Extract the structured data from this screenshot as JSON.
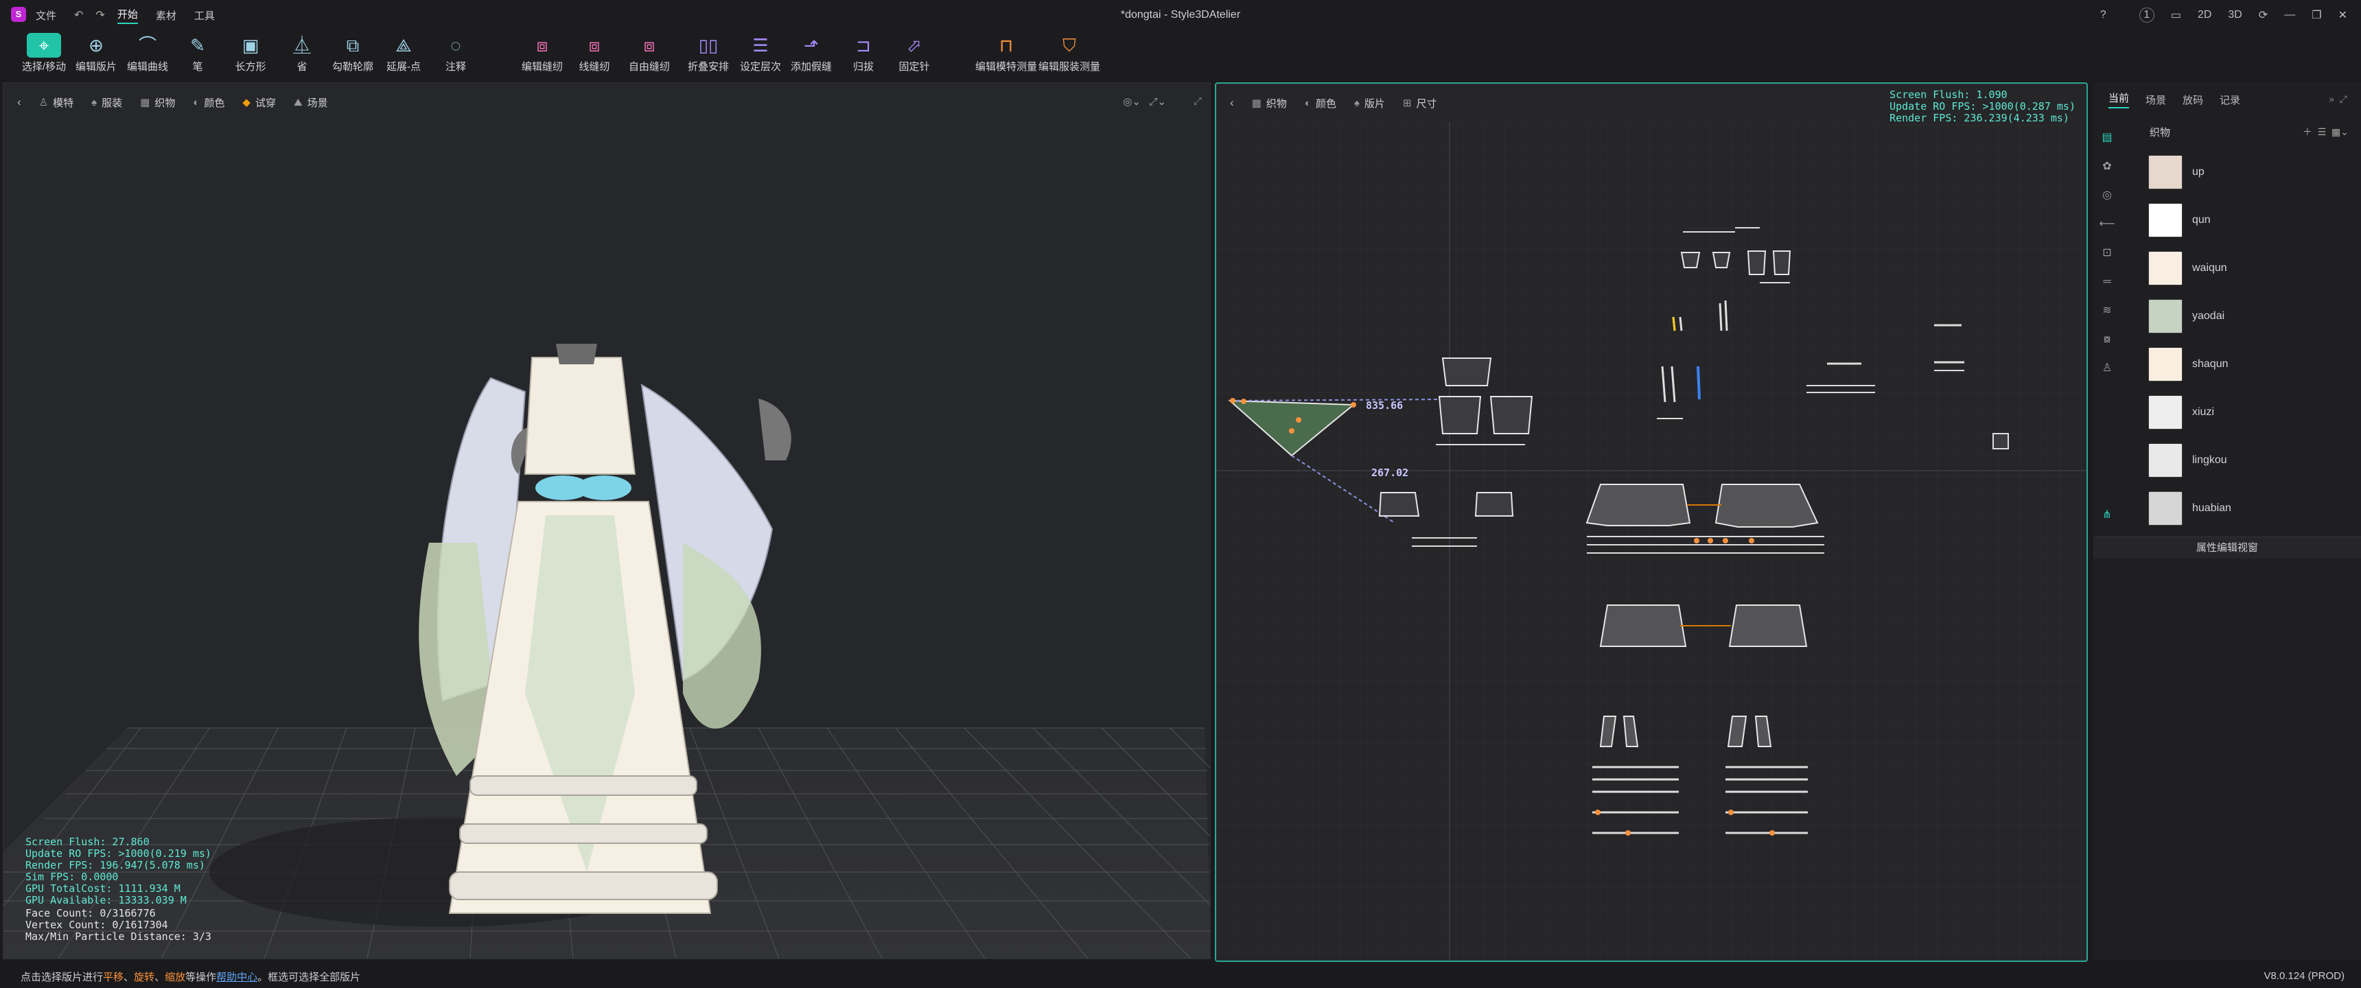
{
  "menu": {
    "items": [
      "文件",
      "开始",
      "素材",
      "工具"
    ],
    "active_index": 1,
    "doc_title": "*dongtai - Style3DAtelier",
    "badge_count": "1",
    "view_modes": [
      "2D",
      "3D"
    ]
  },
  "toolbar": {
    "tools": [
      {
        "label": "选择/移动",
        "icon": "select-move-icon"
      },
      {
        "label": "编辑版片",
        "icon": "edit-pattern-icon"
      },
      {
        "label": "编辑曲线",
        "icon": "edit-curve-icon"
      },
      {
        "label": "笔",
        "icon": "pen-icon"
      },
      {
        "label": "长方形",
        "icon": "rectangle-icon"
      },
      {
        "label": "省",
        "icon": "dart-icon"
      },
      {
        "label": "勾勒轮廓",
        "icon": "trace-outline-icon"
      },
      {
        "label": "延展-点",
        "icon": "extend-point-icon"
      },
      {
        "label": "注释",
        "icon": "annotation-icon"
      },
      {
        "label": "编辑缝纫",
        "icon": "edit-sewing-icon"
      },
      {
        "label": "线缝纫",
        "icon": "line-sewing-icon"
      },
      {
        "label": "自由缝纫",
        "icon": "free-sewing-icon"
      },
      {
        "label": "折叠安排",
        "icon": "fold-arrange-icon"
      },
      {
        "label": "设定层次",
        "icon": "set-layer-icon"
      },
      {
        "label": "添加假缝",
        "icon": "add-tack-icon"
      },
      {
        "label": "归拔",
        "icon": "shrink-stretch-icon"
      },
      {
        "label": "固定针",
        "icon": "pin-icon"
      },
      {
        "label": "编辑模特测量",
        "icon": "edit-avatar-measure-icon"
      },
      {
        "label": "编辑服装测量",
        "icon": "edit-garment-measure-icon"
      }
    ]
  },
  "view3d": {
    "toolbar": [
      "模特",
      "服装",
      "织物",
      "颜色",
      "试穿",
      "场景"
    ],
    "stats_cyan": [
      "Screen Flush: 27.860",
      "Update RO FPS: >1000(0.219 ms)",
      "Render FPS: 196.947(5.078 ms)",
      "Sim FPS: 0.0000",
      "GPU TotalCost: 1111.934 M",
      "GPU Available: 13333.039 M"
    ],
    "stats_white": [
      "Face Count: 0/3166776",
      "Vertex Count: 0/1617304",
      "Max/Min Particle Distance: 3/3"
    ]
  },
  "view2d": {
    "toolbar": [
      "织物",
      "颜色",
      "版片",
      "尺寸"
    ],
    "stats": [
      "Screen Flush: 1.090",
      "Update RO FPS: >1000(0.287 ms)",
      "Render FPS: 236.239(4.233 ms)"
    ],
    "measure_a": "835.66",
    "measure_b": "267.02"
  },
  "side": {
    "tabs": [
      "当前",
      "场景",
      "放码",
      "记录"
    ],
    "active_tab": 0,
    "section_title": "织物",
    "fabrics": [
      {
        "name": "up",
        "color": "#e6d8cc"
      },
      {
        "name": "qun",
        "color": "#ffffff"
      },
      {
        "name": "waiqun",
        "color": "#f8efe2"
      },
      {
        "name": "yaodai",
        "color": "#c6d3c3"
      },
      {
        "name": "shaqun",
        "color": "#f9eee0"
      },
      {
        "name": "xiuzi",
        "color": "#eeeeee"
      },
      {
        "name": "lingkou",
        "color": "#e9e9e9"
      },
      {
        "name": "huabian",
        "color": "#d6d6d6"
      }
    ],
    "prop_title": "属性编辑视窗"
  },
  "status": {
    "prefix": "点击选择版片进行",
    "op1": "平移",
    "sep1": "、",
    "op2": "旋转",
    "sep2": "、",
    "op3": "缩放",
    "mid": "等操作",
    "link": "帮助中心",
    "suffix": "。框选可选择全部版片",
    "version": "V8.0.124 (PROD)"
  }
}
